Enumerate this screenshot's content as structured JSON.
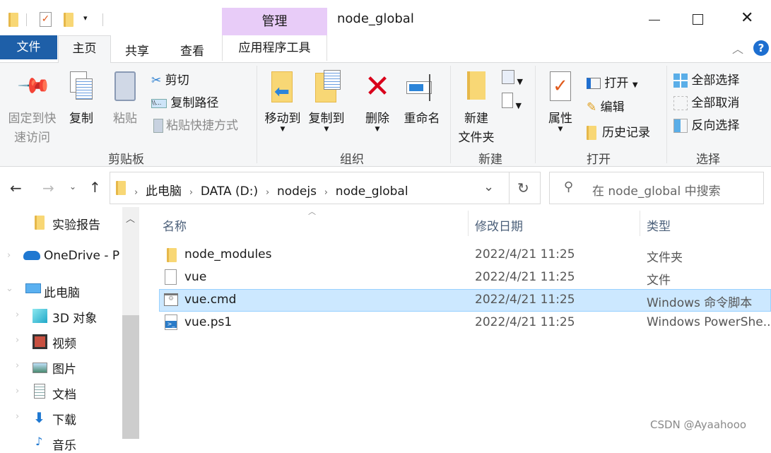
{
  "title": {
    "window_title": "node_global",
    "context_tab": "管理",
    "context_color": "#e8ccf8"
  },
  "tabs": [
    {
      "label": "文件",
      "active_color": "#1e5fa8"
    },
    {
      "label": "主页"
    },
    {
      "label": "共享"
    },
    {
      "label": "查看"
    },
    {
      "label": "应用程序工具"
    }
  ],
  "ribbon": {
    "clipboard": {
      "group": "剪贴板",
      "pin": "固定到快\n速访问",
      "pin1": "固定到快",
      "pin2": "速访问",
      "copy": "复制",
      "paste": "粘贴",
      "cut": "剪切",
      "copy_path": "复制路径",
      "paste_shortcut": "粘贴快捷方式"
    },
    "organize": {
      "group": "组织",
      "move_to": "移动到",
      "copy_to": "复制到",
      "delete": "删除",
      "rename": "重命名"
    },
    "new": {
      "group": "新建",
      "new_folder1": "新建",
      "new_folder2": "文件夹"
    },
    "open": {
      "group": "打开",
      "properties": "属性",
      "open": "打开",
      "edit": "编辑",
      "history": "历史记录"
    },
    "select": {
      "group": "选择",
      "select_all": "全部选择",
      "select_none": "全部取消",
      "invert": "反向选择"
    }
  },
  "address": {
    "crumbs": [
      "此电脑",
      "DATA (D:)",
      "nodejs",
      "node_global"
    ],
    "search_placeholder": "在 node_global 中搜索"
  },
  "nav": {
    "items": [
      "实验报告",
      "OneDrive - P",
      "此电脑",
      "3D 对象",
      "视频",
      "图片",
      "文档",
      "下载",
      "音乐"
    ]
  },
  "columns": {
    "name": "名称",
    "date": "修改日期",
    "type": "类型"
  },
  "files": [
    {
      "name": "node_modules",
      "date": "2022/4/21 11:25",
      "type": "文件夹",
      "icon": "folder-icon"
    },
    {
      "name": "vue",
      "date": "2022/4/21 11:25",
      "type": "文件",
      "icon": "file-icon"
    },
    {
      "name": "vue.cmd",
      "date": "2022/4/21 11:25",
      "type": "Windows 命令脚本",
      "icon": "cmd-script-icon",
      "selected": true
    },
    {
      "name": "vue.ps1",
      "date": "2022/4/21 11:25",
      "type": "Windows PowerShe...",
      "icon": "powershell-icon"
    }
  ],
  "watermark": "CSDN @Ayaahooo"
}
